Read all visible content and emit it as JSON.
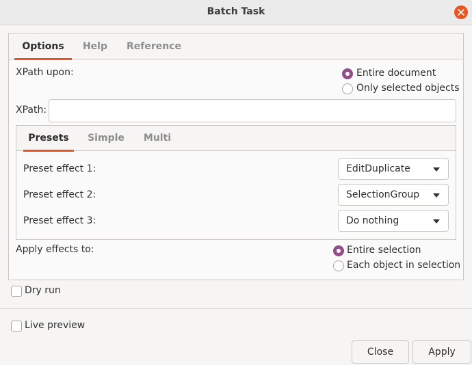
{
  "window": {
    "title": "Batch Task"
  },
  "tabs": [
    {
      "label": "Options"
    },
    {
      "label": "Help"
    },
    {
      "label": "Reference"
    }
  ],
  "xpath_upon": {
    "label": "XPath upon:",
    "options": [
      {
        "label": "Entire document",
        "selected": true
      },
      {
        "label": "Only selected objects",
        "selected": false
      }
    ]
  },
  "xpath": {
    "label": "XPath:",
    "value": ""
  },
  "subtabs": [
    {
      "label": "Presets"
    },
    {
      "label": "Simple"
    },
    {
      "label": "Multi"
    }
  ],
  "presets": [
    {
      "label": "Preset effect 1:",
      "value": "EditDuplicate"
    },
    {
      "label": "Preset effect 2:",
      "value": "SelectionGroup"
    },
    {
      "label": "Preset effect 3:",
      "value": "Do nothing"
    }
  ],
  "apply_to": {
    "label": "Apply effects to:",
    "options": [
      {
        "label": "Entire selection",
        "selected": true
      },
      {
        "label": "Each object in selection",
        "selected": false
      }
    ]
  },
  "dry_run": {
    "label": "Dry run",
    "checked": false
  },
  "live_preview": {
    "label": "Live preview",
    "checked": false
  },
  "buttons": {
    "close": "Close",
    "apply": "Apply"
  },
  "colors": {
    "accent": "#e95420",
    "radio_selected": "#924d8b"
  }
}
